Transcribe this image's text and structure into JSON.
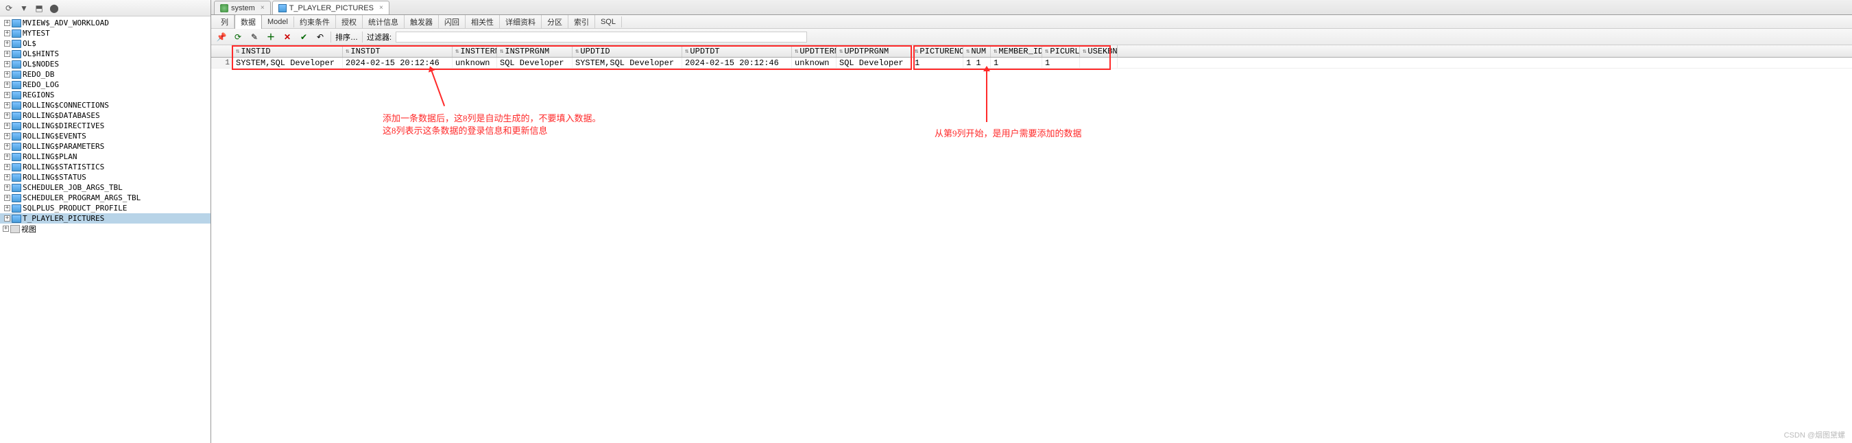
{
  "sidebar": {
    "items": [
      {
        "label": "MVIEW$_ADV_WORKLOAD"
      },
      {
        "label": "MYTEST"
      },
      {
        "label": "OL$"
      },
      {
        "label": "OL$HINTS"
      },
      {
        "label": "OL$NODES"
      },
      {
        "label": "REDO_DB"
      },
      {
        "label": "REDO_LOG"
      },
      {
        "label": "REGIONS"
      },
      {
        "label": "ROLLING$CONNECTIONS"
      },
      {
        "label": "ROLLING$DATABASES"
      },
      {
        "label": "ROLLING$DIRECTIVES"
      },
      {
        "label": "ROLLING$EVENTS"
      },
      {
        "label": "ROLLING$PARAMETERS"
      },
      {
        "label": "ROLLING$PLAN"
      },
      {
        "label": "ROLLING$STATISTICS"
      },
      {
        "label": "ROLLING$STATUS"
      },
      {
        "label": "SCHEDULER_JOB_ARGS_TBL"
      },
      {
        "label": "SCHEDULER_PROGRAM_ARGS_TBL"
      },
      {
        "label": "SQLPLUS_PRODUCT_PROFILE"
      },
      {
        "label": "T_PLAYLER_PICTURES",
        "selected": true
      }
    ],
    "view_label": "视图"
  },
  "tabs": [
    {
      "label": "system",
      "type": "db"
    },
    {
      "label": "T_PLAYLER_PICTURES",
      "type": "table",
      "active": true
    }
  ],
  "subtabs": [
    "列",
    "数据",
    "Model",
    "约束条件",
    "授权",
    "统计信息",
    "触发器",
    "闪回",
    "相关性",
    "详细资料",
    "分区",
    "索引",
    "SQL"
  ],
  "subtab_active_index": 1,
  "action_bar": {
    "sort_label": "排序…",
    "filter_label": "过滤器:",
    "filter_value": ""
  },
  "grid": {
    "columns": [
      {
        "name": "INSTID",
        "w": 160
      },
      {
        "name": "INSTDT",
        "w": 160
      },
      {
        "name": "INSTTERM",
        "w": 65
      },
      {
        "name": "INSTPRGNM",
        "w": 110
      },
      {
        "name": "UPDTID",
        "w": 160
      },
      {
        "name": "UPDTDT",
        "w": 160
      },
      {
        "name": "UPDTTERM",
        "w": 65
      },
      {
        "name": "UPDTPRGNM",
        "w": 110
      },
      {
        "name": "PICTURENO",
        "w": 75
      },
      {
        "name": "NUM",
        "w": 40
      },
      {
        "name": "MEMBER_ID",
        "w": 75
      },
      {
        "name": "PICURL",
        "w": 55
      },
      {
        "name": "USEKBN",
        "w": 55
      }
    ],
    "rows": [
      {
        "n": 1,
        "cells": [
          "SYSTEM,SQL Developer",
          "2024-02-15 20:12:46",
          "unknown",
          "SQL Developer",
          "SYSTEM,SQL Developer",
          "2024-02-15 20:12:46",
          "unknown",
          "SQL Developer",
          "1",
          "1 1",
          "1",
          "1",
          ""
        ]
      }
    ]
  },
  "annotations": {
    "left_text_1": "添加一条数据后，这8列是自动生成的，不要填入数据。",
    "left_text_2": "这8列表示这条数据的登录信息和更新信息",
    "right_text": "从第9列开始，是用户需要添加的数据"
  },
  "watermark": "CSDN @烟图黛螺"
}
